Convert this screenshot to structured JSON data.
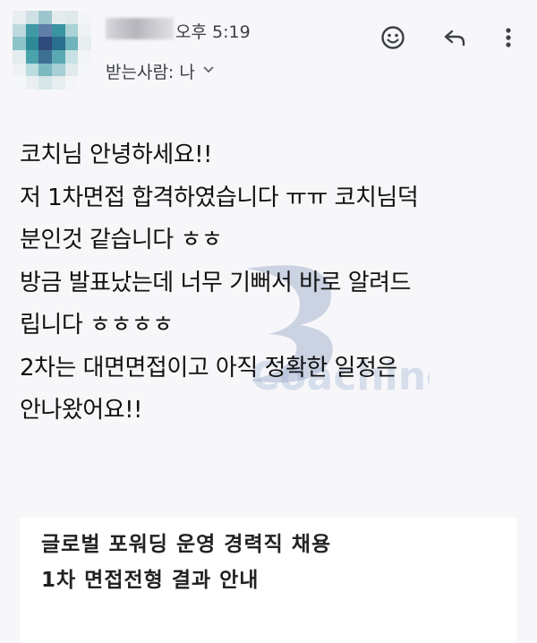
{
  "header": {
    "time": "오후 5:19",
    "recipient_label": "받는사람: 나",
    "chevron": "chevron-down-icon",
    "actions": [
      "emoji-reaction-icon",
      "reply-icon",
      "more-vert-icon"
    ]
  },
  "message": {
    "lines": [
      "코치님 안녕하세요!!",
      "저 1차면접 합격하였습니다 ㅠㅠ 코치님덕",
      "분인것 같습니다 ㅎㅎ",
      "방금 발표났는데 너무 기뻐서 바로 알려드",
      "립니다 ㅎㅎㅎㅎ",
      "2차는 대면면접이고 아직 정확한 일정은",
      "안나왔어요!!"
    ]
  },
  "watermark": {
    "text": "Coaching"
  },
  "quoted_card": {
    "title_lines": [
      "글로벌 포워딩 운영 경력직 채용",
      "1차 면접전형 결과 안내"
    ]
  },
  "colors": {
    "background": "#f7f7fa",
    "text": "#111111",
    "icon": "#3c4043",
    "watermark": "#7d93b8"
  }
}
